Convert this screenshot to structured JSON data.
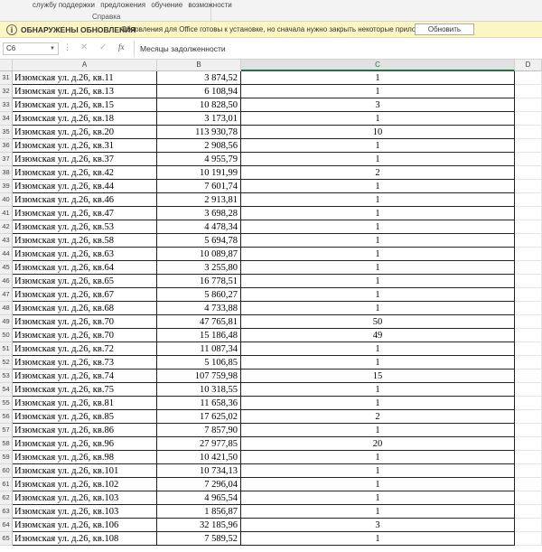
{
  "ribbon": {
    "items": [
      "службу поддержки",
      "предложения",
      "обучение",
      "возможности"
    ],
    "group_label": "Справка"
  },
  "message_bar": {
    "icon": "info-icon",
    "title": "ОБНАРУЖЕНЫ ОБНОВЛЕНИЯ",
    "text": "Обновления для Office готовы к установке, но сначала нужно закрыть некоторые приложения.",
    "button": "Обновить",
    "background": "#fcf5c4"
  },
  "formula_bar": {
    "name_box": "C6",
    "content": "Месяцы задолженности"
  },
  "sheet": {
    "columns": [
      "A",
      "B",
      "C",
      "D"
    ],
    "selected_column": "C",
    "rows": [
      {
        "n": "31",
        "a": "Изюмская ул. д.26, кв.11",
        "b": "3 874,52",
        "c": "1"
      },
      {
        "n": "32",
        "a": "Изюмская ул. д.26, кв.13",
        "b": "6 108,94",
        "c": "1"
      },
      {
        "n": "33",
        "a": "Изюмская ул. д.26, кв.15",
        "b": "10 828,50",
        "c": "3"
      },
      {
        "n": "34",
        "a": "Изюмская ул. д.26, кв.18",
        "b": "3 173,01",
        "c": "1"
      },
      {
        "n": "35",
        "a": "Изюмская ул. д.26, кв.20",
        "b": "113 930,78",
        "c": "10"
      },
      {
        "n": "36",
        "a": "Изюмская ул. д.26, кв.31",
        "b": "2 908,56",
        "c": "1"
      },
      {
        "n": "37",
        "a": "Изюмская ул. д.26, кв.37",
        "b": "4 955,79",
        "c": "1"
      },
      {
        "n": "38",
        "a": "Изюмская ул. д.26, кв.42",
        "b": "10 191,99",
        "c": "2"
      },
      {
        "n": "39",
        "a": "Изюмская ул. д.26, кв.44",
        "b": "7 601,74",
        "c": "1"
      },
      {
        "n": "40",
        "a": "Изюмская ул. д.26, кв.46",
        "b": "2 913,81",
        "c": "1"
      },
      {
        "n": "41",
        "a": "Изюмская ул. д.26, кв.47",
        "b": "3 698,28",
        "c": "1"
      },
      {
        "n": "42",
        "a": "Изюмская ул. д.26, кв.53",
        "b": "4 478,34",
        "c": "1"
      },
      {
        "n": "43",
        "a": "Изюмская ул. д.26, кв.58",
        "b": "5 694,78",
        "c": "1"
      },
      {
        "n": "44",
        "a": "Изюмская ул. д.26, кв.63",
        "b": "10 089,87",
        "c": "1"
      },
      {
        "n": "45",
        "a": "Изюмская ул. д.26, кв.64",
        "b": "3 255,80",
        "c": "1"
      },
      {
        "n": "46",
        "a": "Изюмская ул. д.26, кв.65",
        "b": "16 778,51",
        "c": "1"
      },
      {
        "n": "47",
        "a": "Изюмская ул. д.26, кв.67",
        "b": "5 860,27",
        "c": "1"
      },
      {
        "n": "48",
        "a": "Изюмская ул. д.26, кв.68",
        "b": "4 733,88",
        "c": "1"
      },
      {
        "n": "49",
        "a": "Изюмская ул. д.26, кв.70",
        "b": "47 765,81",
        "c": "50"
      },
      {
        "n": "50",
        "a": "Изюмская ул. д.26, кв.70",
        "b": "15 186,48",
        "c": "49"
      },
      {
        "n": "51",
        "a": "Изюмская ул. д.26, кв.72",
        "b": "11 087,34",
        "c": "1"
      },
      {
        "n": "52",
        "a": "Изюмская ул. д.26, кв.73",
        "b": "5 106,85",
        "c": "1"
      },
      {
        "n": "53",
        "a": "Изюмская ул. д.26, кв.74",
        "b": "107 759,98",
        "c": "15"
      },
      {
        "n": "54",
        "a": "Изюмская ул. д.26, кв.75",
        "b": "10 318,55",
        "c": "1"
      },
      {
        "n": "55",
        "a": "Изюмская ул. д.26, кв.81",
        "b": "11 658,36",
        "c": "1"
      },
      {
        "n": "56",
        "a": "Изюмская ул. д.26, кв.85",
        "b": "17 625,02",
        "c": "2"
      },
      {
        "n": "57",
        "a": "Изюмская ул. д.26, кв.86",
        "b": "7 857,90",
        "c": "1"
      },
      {
        "n": "58",
        "a": "Изюмская ул. д.26, кв.96",
        "b": "27 977,85",
        "c": "20"
      },
      {
        "n": "59",
        "a": "Изюмская ул. д.26, кв.98",
        "b": "10 421,50",
        "c": "1"
      },
      {
        "n": "60",
        "a": "Изюмская ул. д.26, кв.101",
        "b": "10 734,13",
        "c": "1"
      },
      {
        "n": "61",
        "a": "Изюмская ул. д.26, кв.102",
        "b": "7 296,04",
        "c": "1"
      },
      {
        "n": "62",
        "a": "Изюмская ул. д.26, кв.103",
        "b": "4 965,54",
        "c": "1"
      },
      {
        "n": "63",
        "a": "Изюмская ул. д.26, кв.103",
        "b": "1 856,87",
        "c": "1"
      },
      {
        "n": "64",
        "a": "Изюмская ул. д.26, кв.106",
        "b": "32 185,96",
        "c": "3"
      },
      {
        "n": "65",
        "a": "Изюмская ул. д.26, кв.108",
        "b": "7 589,52",
        "c": "1"
      }
    ]
  }
}
